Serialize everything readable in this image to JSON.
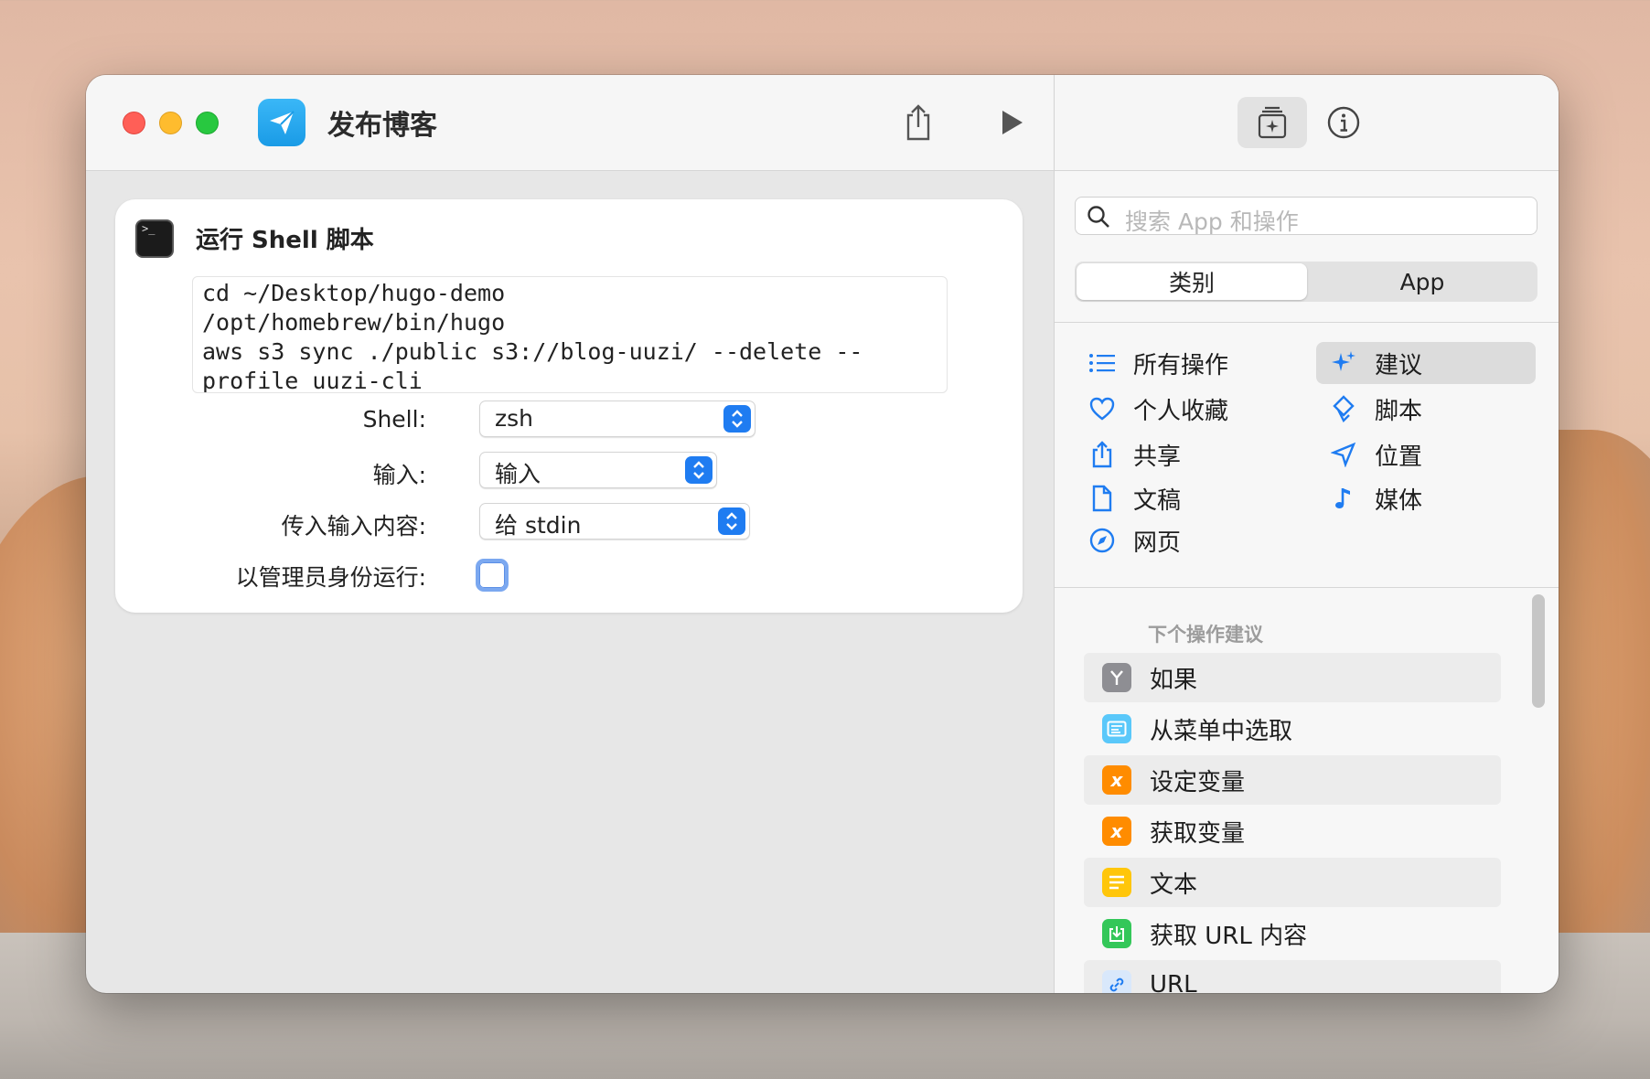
{
  "window": {
    "title": "发布博客"
  },
  "action": {
    "title": "运行 Shell 脚本",
    "script": "cd ~/Desktop/hugo-demo\n/opt/homebrew/bin/hugo\naws s3 sync ./public s3://blog-uuzi/ --delete --\nprofile uuzi-cli",
    "shell_label": "Shell:",
    "shell_value": "zsh",
    "input_label": "输入:",
    "input_value": "输入",
    "pass_label": "传入输入内容:",
    "pass_value": "给 stdin",
    "admin_label": "以管理员身份运行:"
  },
  "sidebar": {
    "search_placeholder": "搜索 App 和操作",
    "segments": [
      "类别",
      "App"
    ],
    "categories": [
      {
        "label": "所有操作",
        "icon": "list-icon"
      },
      {
        "label": "建议",
        "icon": "sparkles-icon"
      },
      {
        "label": "个人收藏",
        "icon": "heart-icon"
      },
      {
        "label": "脚本",
        "icon": "script-icon"
      },
      {
        "label": "共享",
        "icon": "share-icon"
      },
      {
        "label": "位置",
        "icon": "location-arrow-icon"
      },
      {
        "label": "文稿",
        "icon": "document-icon"
      },
      {
        "label": "媒体",
        "icon": "music-note-icon"
      },
      {
        "label": "网页",
        "icon": "compass-icon"
      }
    ],
    "next_title": "下个操作建议",
    "suggestions": [
      {
        "label": "如果",
        "icon": "if-branch-icon",
        "color": "#8e8e93"
      },
      {
        "label": "从菜单中选取",
        "icon": "menu-icon",
        "color": "#5ac8fa"
      },
      {
        "label": "设定变量",
        "icon": "variable-icon",
        "color": "#ff8c00"
      },
      {
        "label": "获取变量",
        "icon": "variable-icon",
        "color": "#ff8c00"
      },
      {
        "label": "文本",
        "icon": "text-icon",
        "color": "#ffc60a"
      },
      {
        "label": "获取 URL 内容",
        "icon": "download-icon",
        "color": "#34c759"
      },
      {
        "label": "URL",
        "icon": "link-icon",
        "color": "#d9e8fb"
      }
    ]
  }
}
